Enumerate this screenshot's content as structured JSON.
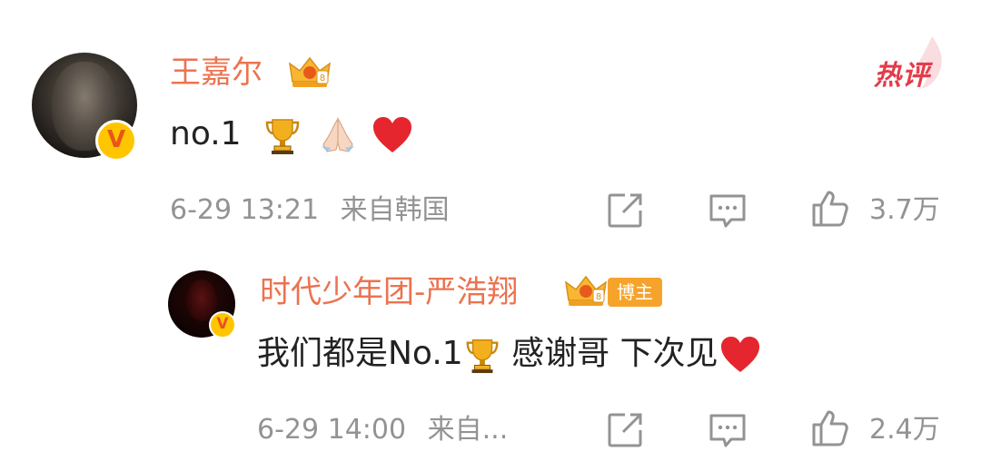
{
  "hot_label": "热评",
  "comment": {
    "username": "王嘉尔",
    "text": "no.1",
    "emojis": [
      "trophy-icon",
      "praying-hands-icon",
      "red-heart-icon"
    ],
    "time": "6-29 13:21",
    "location": "来自韩国",
    "likes": "3.7万",
    "badge_icon": "crown-badge-icon",
    "verified_icon": "verified-v-icon"
  },
  "reply": {
    "username": "时代少年团-严浩翔",
    "tag": "博主",
    "text_part1": "我们都是No.1",
    "text_part2": " 感谢哥 下次见",
    "emojis": [
      "trophy-icon",
      "red-heart-icon"
    ],
    "time": "6-29 14:00",
    "location": "来自...",
    "likes": "2.4万",
    "badge_icon": "crown-badge-icon",
    "verified_icon": "verified-v-icon"
  },
  "colors": {
    "username": "#eb7350",
    "meta": "#939393",
    "verified": "#ffc600",
    "hot": "#e43b4a",
    "tag_bg": "#f6a32b"
  }
}
